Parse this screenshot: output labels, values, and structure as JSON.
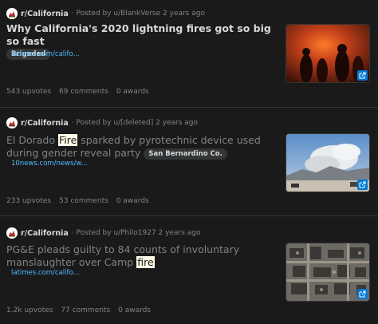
{
  "posts": [
    {
      "subreddit": "r/California",
      "posted_by": "· Posted by u/BlankVerse 2 years ago",
      "title": "Why California's 2020 lightning fires got so big so fast",
      "flair": "Brigaded",
      "link": "latimes.com/califo...",
      "upvotes": "543 upvotes",
      "comments": "69 comments",
      "awards": "0 awards",
      "thumbnail": "night-fire-crowd-photo",
      "icon": "subreddit-icon"
    },
    {
      "subreddit": "r/California",
      "posted_by": "· Posted by u/[deleted] 2 years ago",
      "title_before": "El Dorado ",
      "title_highlight": "Fire",
      "title_after": " sparked by pyrotechnic device used during gender reveal party",
      "flair": "San Bernardino Co.",
      "link": "10news.com/news/w...",
      "upvotes": "233 upvotes",
      "comments": "53 comments",
      "awards": "0 awards",
      "thumbnail": "smoke-plume-photo",
      "icon": "subreddit-icon"
    },
    {
      "subreddit": "r/California",
      "posted_by": "· Posted by u/Philo1927 2 years ago",
      "title_before": "PG&E pleads guilty to 84 counts of involuntary manslaughter over Camp ",
      "title_highlight": "fire",
      "link": "latimes.com/califo...",
      "upvotes": "1.2k upvotes",
      "comments": "77 comments",
      "awards": "0 awards",
      "thumbnail": "burned-town-aerial-photo",
      "icon": "subreddit-icon"
    }
  ],
  "colors": {
    "background": "#1a1a1b",
    "link": "#4fbcff",
    "highlight": "#fffbe6",
    "external_link_badge": "#0079d3"
  }
}
